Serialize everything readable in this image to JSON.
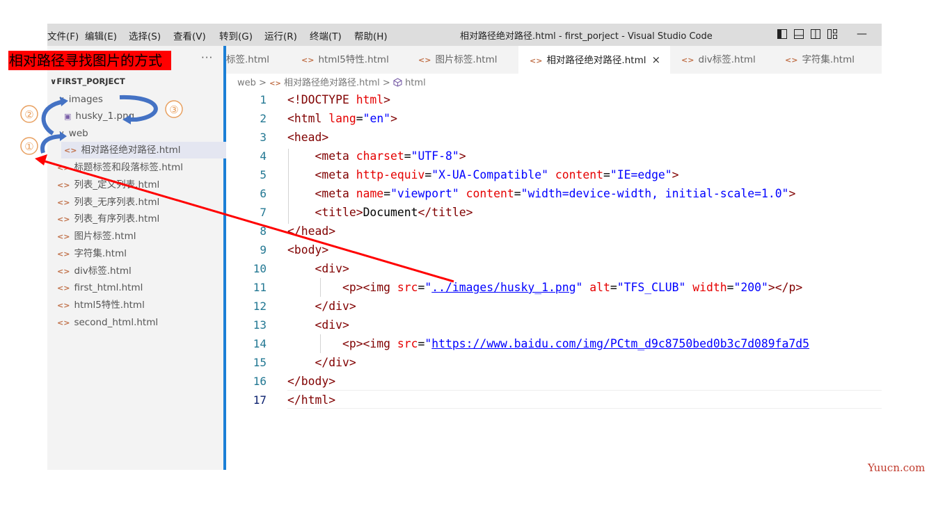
{
  "menubar": {
    "items": [
      "文件(F)",
      "编辑(E)",
      "选择(S)",
      "查看(V)",
      "转到(G)",
      "运行(R)",
      "终端(T)",
      "帮助(H)"
    ],
    "title": "相对路径绝对路径.html - first_porject - Visual Studio Code",
    "minimize": "—"
  },
  "annotation": {
    "label": "相对路径寻找图片的方式",
    "markers": [
      "①",
      "②",
      "③"
    ],
    "color": "#ff0000",
    "arrow_color": "#4472c4"
  },
  "explorer": {
    "more": "···",
    "project": "FIRST_PORJECT",
    "tree": [
      {
        "label": "images",
        "kind": "folder"
      },
      {
        "label": "husky_1.png",
        "kind": "image"
      },
      {
        "label": "web",
        "kind": "folder"
      },
      {
        "label": "相对路径绝对路径.html",
        "kind": "html"
      },
      {
        "label": "标题标签和段落标签.html",
        "kind": "html"
      },
      {
        "label": "列表_定义列表.html",
        "kind": "html"
      },
      {
        "label": "列表_无序列表.html",
        "kind": "html"
      },
      {
        "label": "列表_有序列表.html",
        "kind": "html"
      },
      {
        "label": "图片标签.html",
        "kind": "html"
      },
      {
        "label": "字符集.html",
        "kind": "html"
      },
      {
        "label": "div标签.html",
        "kind": "html"
      },
      {
        "label": "first_html.html",
        "kind": "html"
      },
      {
        "label": "html5特性.html",
        "kind": "html"
      },
      {
        "label": "second_html.html",
        "kind": "html"
      }
    ]
  },
  "tabs": {
    "items": [
      "标签.html",
      "html5特性.html",
      "图片标签.html",
      "相对路径绝对路径.html",
      "div标签.html",
      "字符集.html"
    ],
    "active_index": 3,
    "close": "×"
  },
  "breadcrumb": {
    "folder": "web",
    "sep": ">",
    "file": "相对路径绝对路径.html",
    "element": "html"
  },
  "editor": {
    "line_numbers": [
      "1",
      "2",
      "3",
      "4",
      "5",
      "6",
      "7",
      "8",
      "9",
      "10",
      "11",
      "12",
      "13",
      "14",
      "15",
      "16",
      "17"
    ],
    "lines": [
      {
        "indent": "",
        "parts": [
          [
            "tag",
            "<!DOCTYPE "
          ],
          [
            "attr",
            "html"
          ],
          [
            "tag",
            ">"
          ]
        ]
      },
      {
        "indent": "",
        "parts": [
          [
            "tag",
            "<html "
          ],
          [
            "attr",
            "lang"
          ],
          [
            "txt",
            "="
          ],
          [
            "str",
            "\"en\""
          ],
          [
            "tag",
            ">"
          ]
        ]
      },
      {
        "indent": "",
        "parts": [
          [
            "tag",
            "<head>"
          ]
        ]
      },
      {
        "indent": "    ",
        "parts": [
          [
            "tag",
            "<meta "
          ],
          [
            "attr",
            "charset"
          ],
          [
            "txt",
            "="
          ],
          [
            "str",
            "\"UTF-8\""
          ],
          [
            "tag",
            ">"
          ]
        ]
      },
      {
        "indent": "    ",
        "parts": [
          [
            "tag",
            "<meta "
          ],
          [
            "attr",
            "http-equiv"
          ],
          [
            "txt",
            "="
          ],
          [
            "str",
            "\"X-UA-Compatible\""
          ],
          [
            "txt",
            " "
          ],
          [
            "attr",
            "content"
          ],
          [
            "txt",
            "="
          ],
          [
            "str",
            "\"IE=edge\""
          ],
          [
            "tag",
            ">"
          ]
        ]
      },
      {
        "indent": "    ",
        "parts": [
          [
            "tag",
            "<meta "
          ],
          [
            "attr",
            "name"
          ],
          [
            "txt",
            "="
          ],
          [
            "str",
            "\"viewport\""
          ],
          [
            "txt",
            " "
          ],
          [
            "attr",
            "content"
          ],
          [
            "txt",
            "="
          ],
          [
            "str",
            "\"width=device-width, initial-scale=1.0\""
          ],
          [
            "tag",
            ">"
          ]
        ]
      },
      {
        "indent": "    ",
        "parts": [
          [
            "tag",
            "<title>"
          ],
          [
            "txt",
            "Document"
          ],
          [
            "tag",
            "</title>"
          ]
        ]
      },
      {
        "indent": "",
        "parts": [
          [
            "tag",
            "</head>"
          ]
        ]
      },
      {
        "indent": "",
        "parts": [
          [
            "tag",
            "<body>"
          ]
        ]
      },
      {
        "indent": "    ",
        "parts": [
          [
            "tag",
            "<div>"
          ]
        ]
      },
      {
        "indent": "        ",
        "parts": [
          [
            "tag",
            "<p><img "
          ],
          [
            "attr",
            "src"
          ],
          [
            "txt",
            "="
          ],
          [
            "str",
            "\""
          ],
          [
            "link",
            "../images/husky_1.png"
          ],
          [
            "str",
            "\""
          ],
          [
            "txt",
            " "
          ],
          [
            "attr",
            "alt"
          ],
          [
            "txt",
            "="
          ],
          [
            "str",
            "\"TFS_CLUB\""
          ],
          [
            "txt",
            " "
          ],
          [
            "attr",
            "width"
          ],
          [
            "txt",
            "="
          ],
          [
            "str",
            "\"200\""
          ],
          [
            "tag",
            "></p>"
          ]
        ]
      },
      {
        "indent": "    ",
        "parts": [
          [
            "tag",
            "</div>"
          ]
        ]
      },
      {
        "indent": "    ",
        "parts": [
          [
            "tag",
            "<div>"
          ]
        ]
      },
      {
        "indent": "        ",
        "parts": [
          [
            "tag",
            "<p><img "
          ],
          [
            "attr",
            "src"
          ],
          [
            "txt",
            "="
          ],
          [
            "str",
            "\""
          ],
          [
            "link",
            "https://www.baidu.com/img/PCtm_d9c8750bed0b3c7d089fa7d5"
          ]
        ]
      },
      {
        "indent": "    ",
        "parts": [
          [
            "tag",
            "</div>"
          ]
        ]
      },
      {
        "indent": "",
        "parts": [
          [
            "tag",
            "</body>"
          ]
        ]
      },
      {
        "indent": "",
        "parts": [
          [
            "tag",
            "</html>"
          ]
        ]
      }
    ]
  },
  "watermark": "Yuucn.com"
}
